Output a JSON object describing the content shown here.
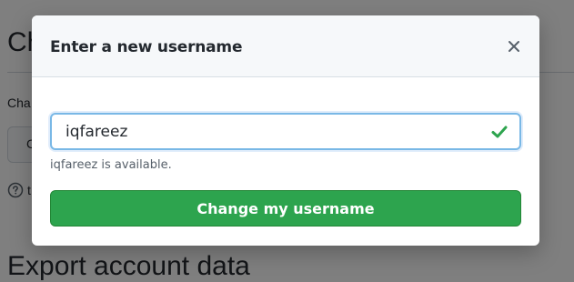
{
  "background": {
    "heading_top": "Ch",
    "label": "Cha",
    "button_text": "C",
    "help_text": "t",
    "heading_bottom": "Export account data"
  },
  "modal": {
    "title": "Enter a new username",
    "close_icon": "close-icon",
    "input": {
      "value": "iqfareez",
      "status_icon": "check-icon",
      "status_color": "#2da44e",
      "focus_border_color": "#79b8e6"
    },
    "availability_note": "iqfareez is available.",
    "submit_label": "Change my username",
    "submit_color": "#2da44e"
  }
}
